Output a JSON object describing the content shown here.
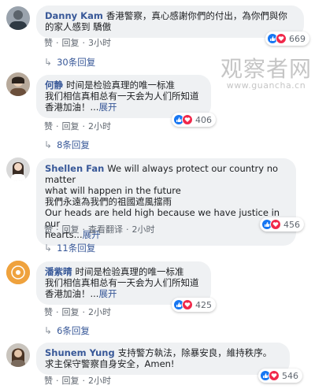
{
  "watermark": {
    "brand": "观察者网",
    "url": "www.guancha.cn"
  },
  "labels": {
    "like": "赞",
    "reply": "回复",
    "see_translation": "查看翻译",
    "see_more": "展开"
  },
  "comments": [
    {
      "author": "Danny Kam",
      "text_lines": [
        "香港警察，真心感謝你們的付出，為你們與你",
        "的家人感到 驕傲"
      ],
      "time": "3小时",
      "reactions": "669",
      "replies": "30条回复"
    },
    {
      "author": "何静",
      "text_lines": [
        "时间是检验真理的唯一标准",
        "我们相信真相总有一天会为人们所知道",
        "香港加油！..."
      ],
      "time": "2小时",
      "reactions": "406",
      "replies": "8条回复"
    },
    {
      "author": "Shellen Fan",
      "text_lines": [
        "We will always protect our country no matter",
        "what will happen in the future",
        "我們永遠為我們的祖國遮風擋雨",
        "Our heads are held high because we have justice in our",
        "hearts..."
      ],
      "time": "2小时",
      "reactions": "456",
      "replies": "11条回复"
    },
    {
      "author": "潘紫晴",
      "text_lines": [
        "时间是检验真理的唯一标准",
        "我们相信真相总有一天会为人们所知道",
        "香港加油！..."
      ],
      "time": "2小时",
      "reactions": "425",
      "replies": "6条回复"
    },
    {
      "author": "Shunem Yung",
      "text_lines": [
        "支持警方執法，除暴安良，維持秩序。",
        "求主保守警察自身安全，Amen!"
      ],
      "time": "2小时",
      "reactions": "546"
    }
  ],
  "colors": {
    "link": "#385898",
    "bubble": "#eff1f3",
    "like": "#1877f2",
    "love": "#f0284a"
  }
}
